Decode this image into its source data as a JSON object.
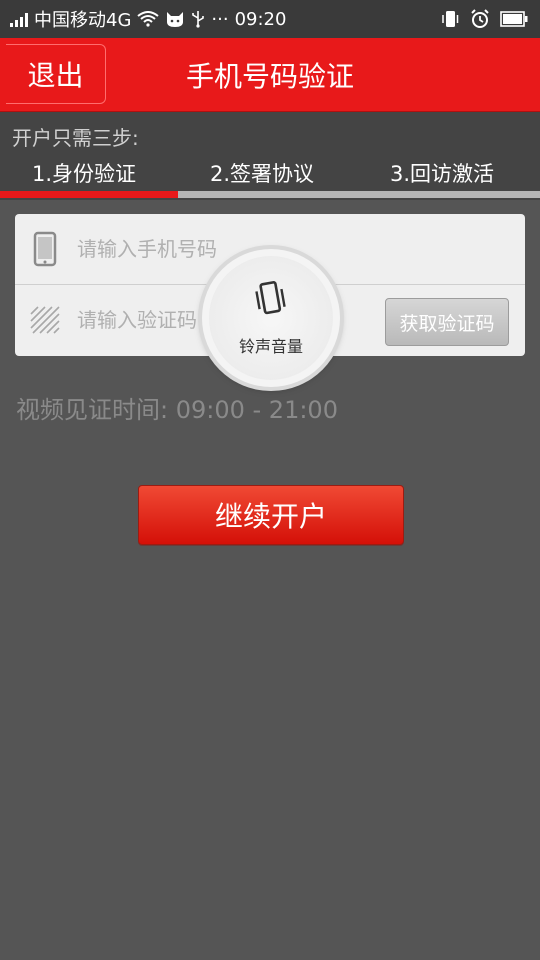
{
  "status_bar": {
    "carrier": "中国移动4G",
    "time": "09:20",
    "dots": "···"
  },
  "header": {
    "back_label": "退出",
    "title": "手机号码验证"
  },
  "steps": {
    "heading": "开户只需三步:",
    "items": [
      "1.身份验证",
      "2.签署协议",
      "3.回访激活"
    ],
    "progress": 0.33
  },
  "form": {
    "phone_placeholder": "请输入手机号码",
    "code_placeholder": "请输入验证码",
    "get_code_label": "获取验证码"
  },
  "video_time": "视频见证时间: 09:00 - 21:00",
  "continue_label": "继续开户",
  "volume_overlay": {
    "label": "铃声音量",
    "icon": "vibrate-icon"
  },
  "colors": {
    "brand_red": "#e8191a",
    "background": "#555555"
  }
}
